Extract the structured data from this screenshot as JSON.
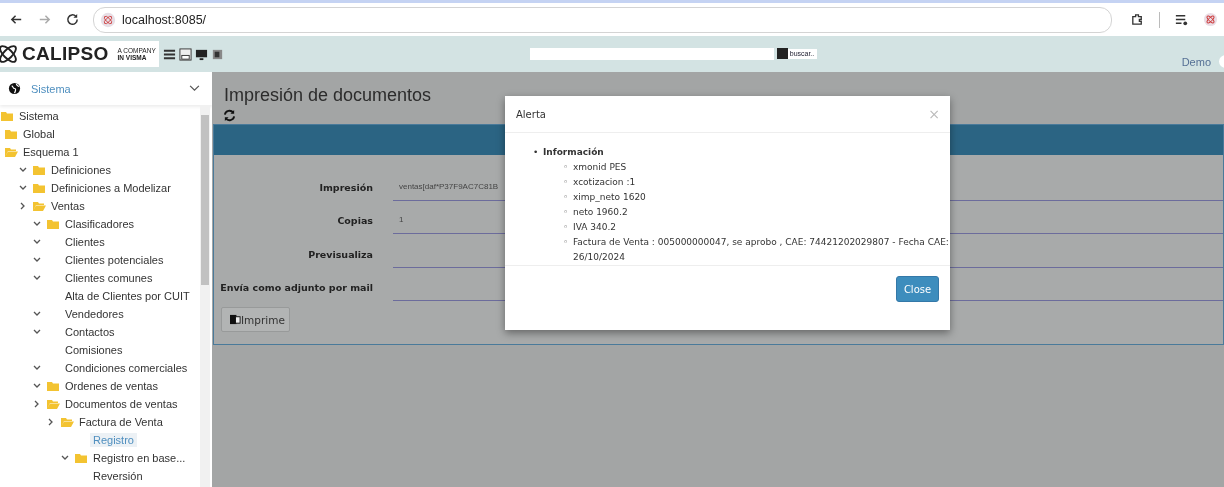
{
  "browser": {
    "url": "localhost:8085/",
    "forward_disabled": true
  },
  "header": {
    "logo": "CALIPSO",
    "tagline": [
      "A COMPANY",
      "IN VISMA"
    ],
    "search_checked": true,
    "search_button": "buscar..",
    "user": "Demo"
  },
  "sidebar": {
    "module": "Sistema",
    "tree": [
      {
        "label": "Sistema",
        "toggle": false,
        "folder": true,
        "folder_open": false,
        "selected": false,
        "children": [
          {
            "label": "Global",
            "toggle": false,
            "folder": true,
            "folder_open": false,
            "selected": false
          },
          {
            "label": "Esquema 1",
            "toggle": false,
            "folder": true,
            "folder_open": true,
            "selected": false,
            "children": [
              {
                "label": "Definiciones",
                "toggle": true,
                "expanded": true,
                "folder": true,
                "folder_open": false,
                "selected": false
              },
              {
                "label": "Definiciones a Modelizar",
                "toggle": true,
                "expanded": true,
                "folder": true,
                "folder_open": false,
                "selected": false
              },
              {
                "label": "Ventas",
                "toggle": true,
                "expanded": false,
                "folder": true,
                "folder_open": true,
                "selected": false,
                "children": [
                  {
                    "label": "Clasificadores",
                    "toggle": true,
                    "expanded": true,
                    "folder": true,
                    "folder_open": false,
                    "selected": false
                  },
                  {
                    "label": "Clientes",
                    "toggle": true,
                    "expanded": true,
                    "folder": false,
                    "selected": false
                  },
                  {
                    "label": "Clientes potenciales",
                    "toggle": true,
                    "expanded": true,
                    "folder": false,
                    "selected": false
                  },
                  {
                    "label": "Clientes comunes",
                    "toggle": true,
                    "expanded": true,
                    "folder": false,
                    "selected": false
                  },
                  {
                    "label": "Alta de Clientes por CUIT",
                    "toggle": false,
                    "folder": false,
                    "selected": false
                  },
                  {
                    "label": "Vendedores",
                    "toggle": true,
                    "expanded": true,
                    "folder": false,
                    "selected": false
                  },
                  {
                    "label": "Contactos",
                    "toggle": true,
                    "expanded": true,
                    "folder": false,
                    "selected": false
                  },
                  {
                    "label": "Comisiones",
                    "toggle": false,
                    "folder": false,
                    "selected": false
                  },
                  {
                    "label": "Condiciones comerciales",
                    "toggle": true,
                    "expanded": true,
                    "folder": false,
                    "selected": false
                  },
                  {
                    "label": "Ordenes de ventas",
                    "toggle": true,
                    "expanded": true,
                    "folder": true,
                    "folder_open": false,
                    "selected": false
                  },
                  {
                    "label": "Documentos de ventas",
                    "toggle": true,
                    "expanded": false,
                    "folder": true,
                    "folder_open": true,
                    "selected": false,
                    "children": [
                      {
                        "label": "Factura de Venta",
                        "toggle": true,
                        "expanded": false,
                        "folder": true,
                        "folder_open": true,
                        "selected": false,
                        "children": [
                          {
                            "label": "Registro",
                            "toggle": false,
                            "folder": false,
                            "selected": true
                          },
                          {
                            "label": "Registro en base...",
                            "toggle": true,
                            "expanded": true,
                            "folder": true,
                            "folder_open": false,
                            "selected": false
                          },
                          {
                            "label": "Reversión",
                            "toggle": false,
                            "folder": false,
                            "selected": false
                          }
                        ]
                      }
                    ]
                  }
                ]
              }
            ]
          }
        ]
      }
    ]
  },
  "main": {
    "title": "Impresión de documentos",
    "fields": [
      {
        "label": "Impresión",
        "value": "ventas[daf*P37F9AC7C81B"
      },
      {
        "label": "Copias",
        "value": "1"
      },
      {
        "label": "Previsualiza"
      },
      {
        "label": "Envía como adjunto por mail"
      }
    ],
    "print_button": "Imprime"
  },
  "modal": {
    "title": "Alerta",
    "close_icon": "×",
    "heading": {
      "bullet": "•",
      "text": "Información"
    },
    "items": [
      {
        "bullet": "◦",
        "text": "xmonid PES"
      },
      {
        "bullet": "◦",
        "text": "xcotizacion :1"
      },
      {
        "bullet": "◦",
        "text": "ximp_neto 1620"
      },
      {
        "bullet": "◦",
        "text": "neto 1960.2"
      },
      {
        "bullet": "◦",
        "text": "IVA 340.2"
      },
      {
        "bullet": "◦",
        "text": "Factura de Venta : 005000000047, se aprobo , CAE: 74421202029807 - Fecha CAE: 26/10/2024"
      }
    ],
    "close_button": "Close"
  }
}
